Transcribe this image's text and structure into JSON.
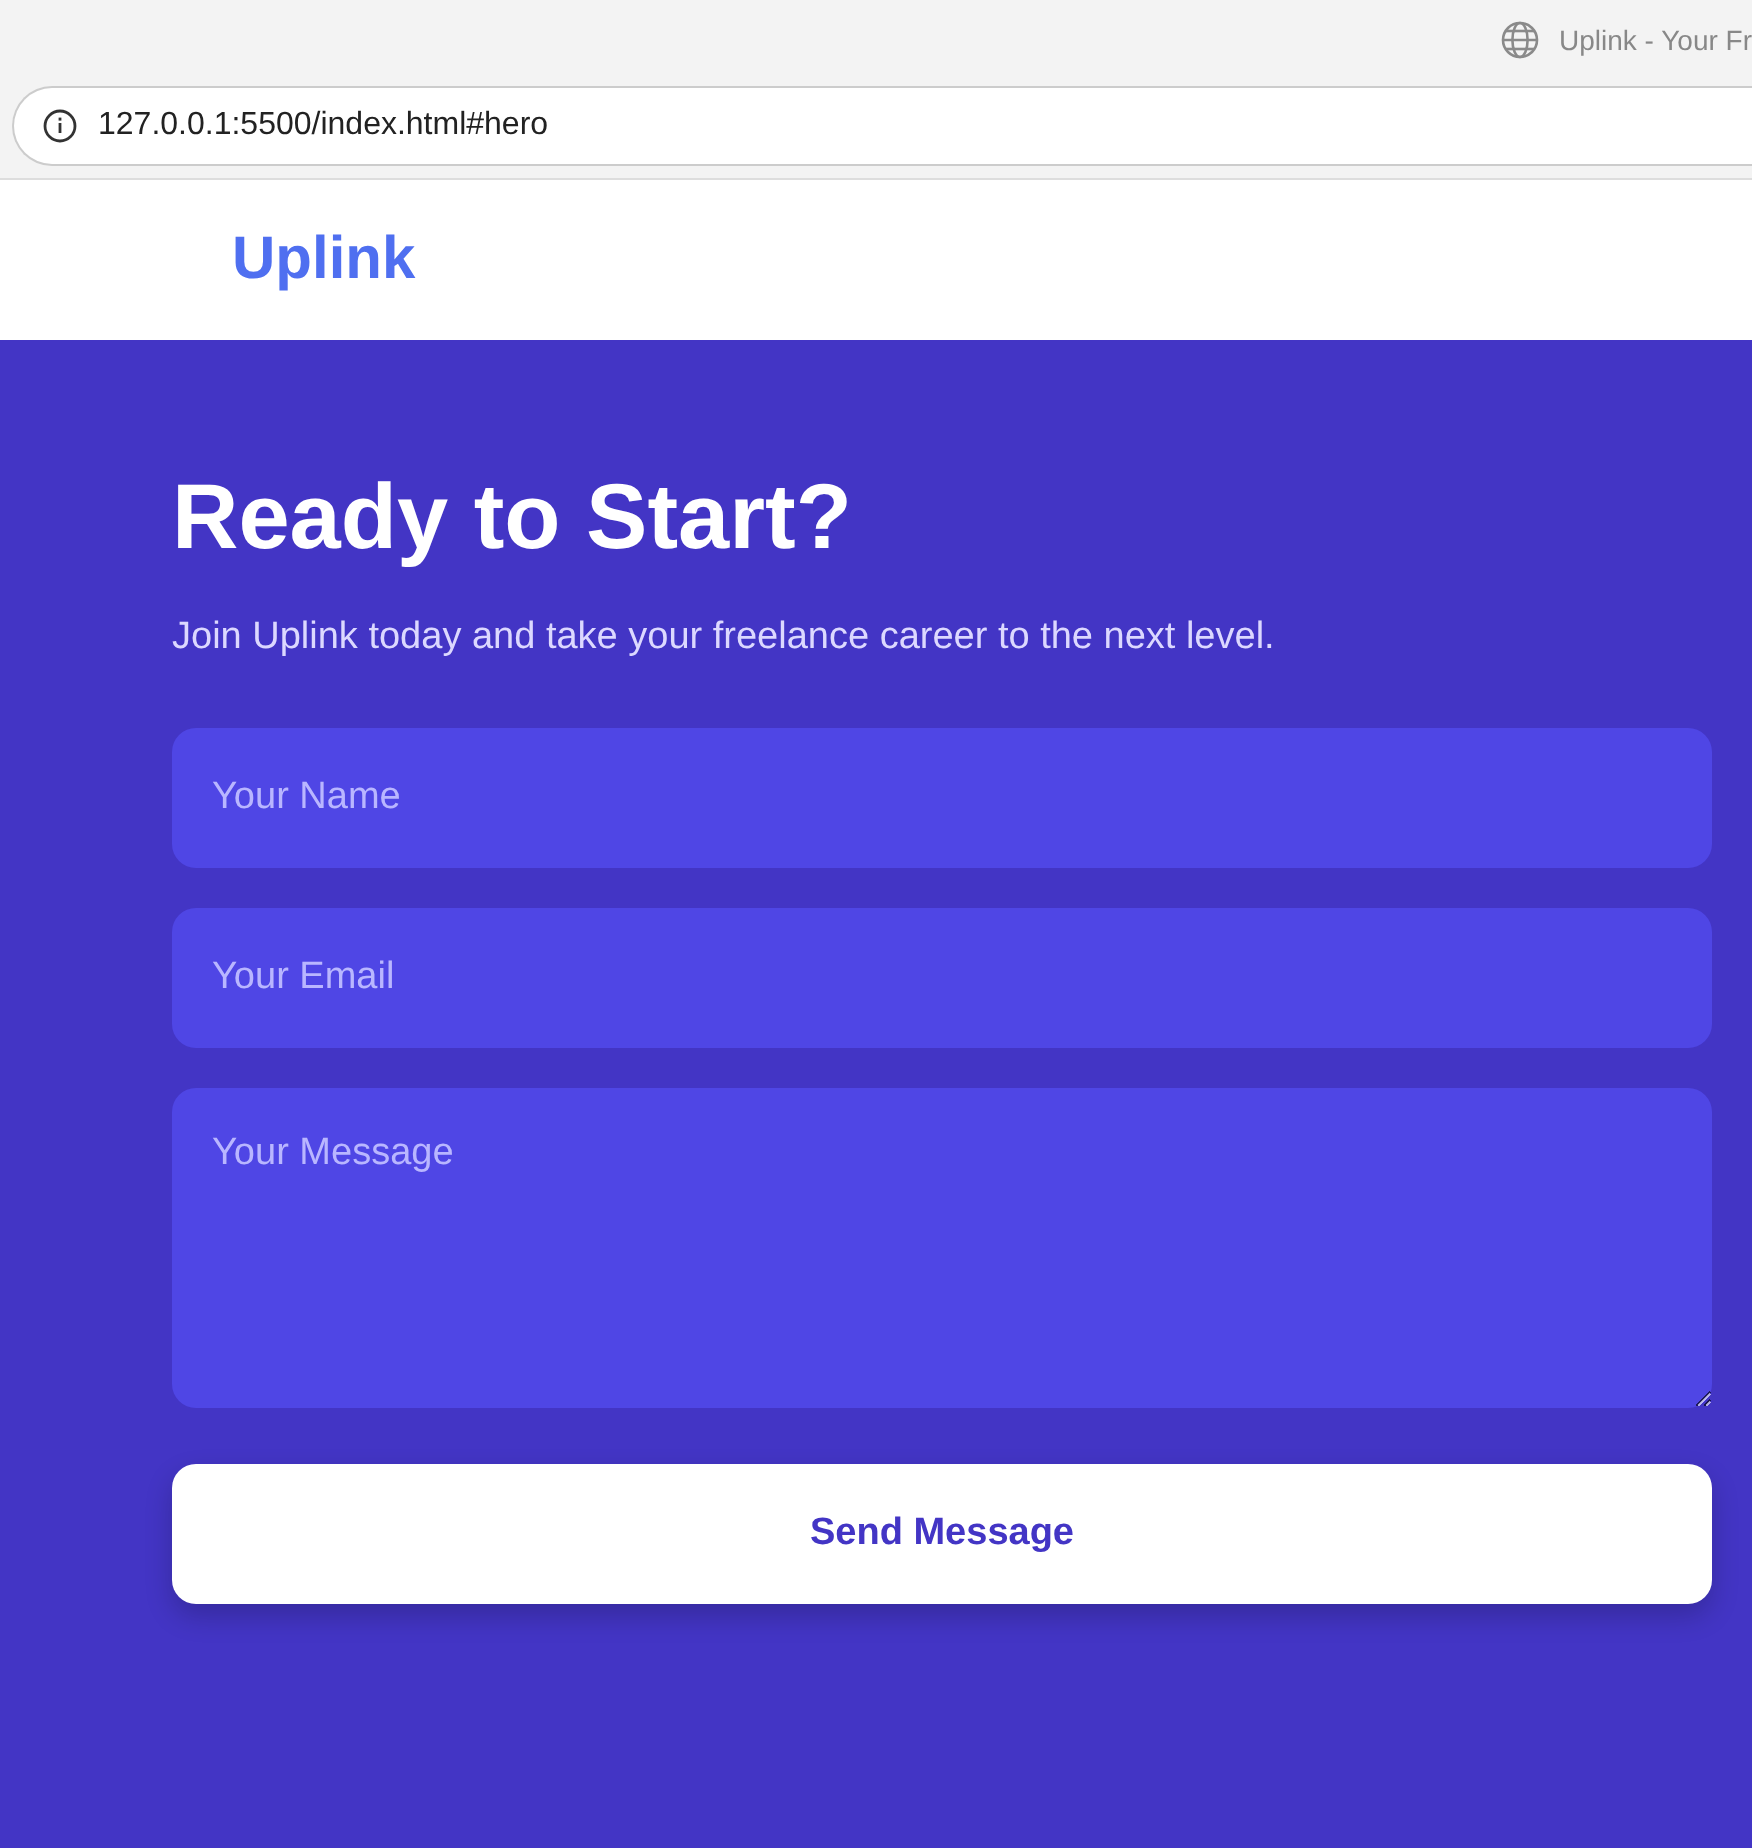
{
  "browser": {
    "tab_title": "Uplink - Your Fr",
    "address": "127.0.0.1:5500/index.html#hero"
  },
  "header": {
    "logo": "Uplink"
  },
  "hero": {
    "title": "Ready to Start?",
    "subtitle": "Join Uplink today and take your freelance career to the next level.",
    "fields": [
      {
        "kind": "input",
        "placeholder": "Your Name"
      },
      {
        "kind": "input",
        "placeholder": "Your Email"
      },
      {
        "kind": "textarea",
        "placeholder": "Your Message"
      }
    ],
    "button": "Send Message"
  }
}
